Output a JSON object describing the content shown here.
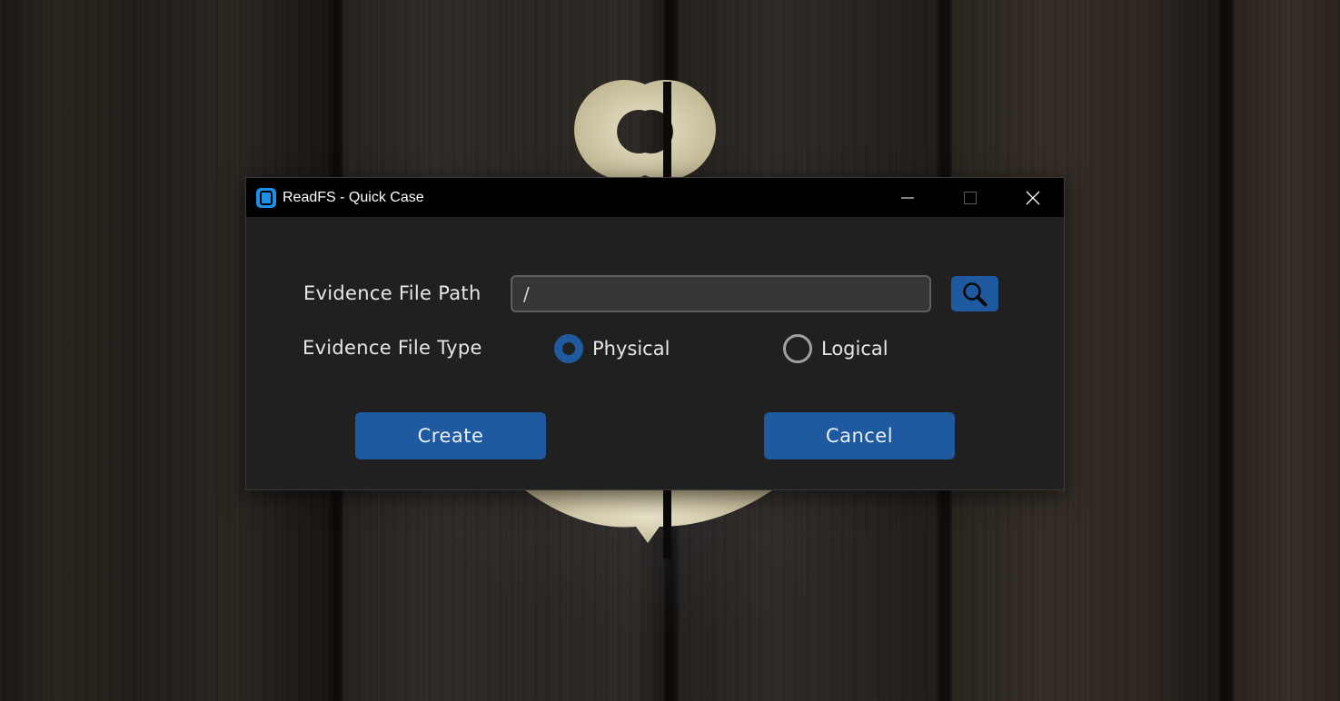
{
  "window": {
    "title": "ReadFS - Quick Case",
    "controls": {
      "minimize_icon": "minimize-icon",
      "maximize_icon": "maximize-icon",
      "close_icon": "close-icon"
    }
  },
  "form": {
    "path_label": "Evidence File Path",
    "path_value": "/",
    "browse_icon": "search-icon",
    "type_label": "Evidence File Type",
    "type_options": [
      {
        "label": "Physical",
        "selected": true
      },
      {
        "label": "Logical",
        "selected": false
      }
    ]
  },
  "actions": {
    "create_label": "Create",
    "cancel_label": "Cancel"
  },
  "colors": {
    "accent": "#1f5aa0",
    "app_icon": "#1e90e8",
    "window_bg": "#202020",
    "titlebar_bg": "#000000",
    "input_bg": "#343638"
  }
}
